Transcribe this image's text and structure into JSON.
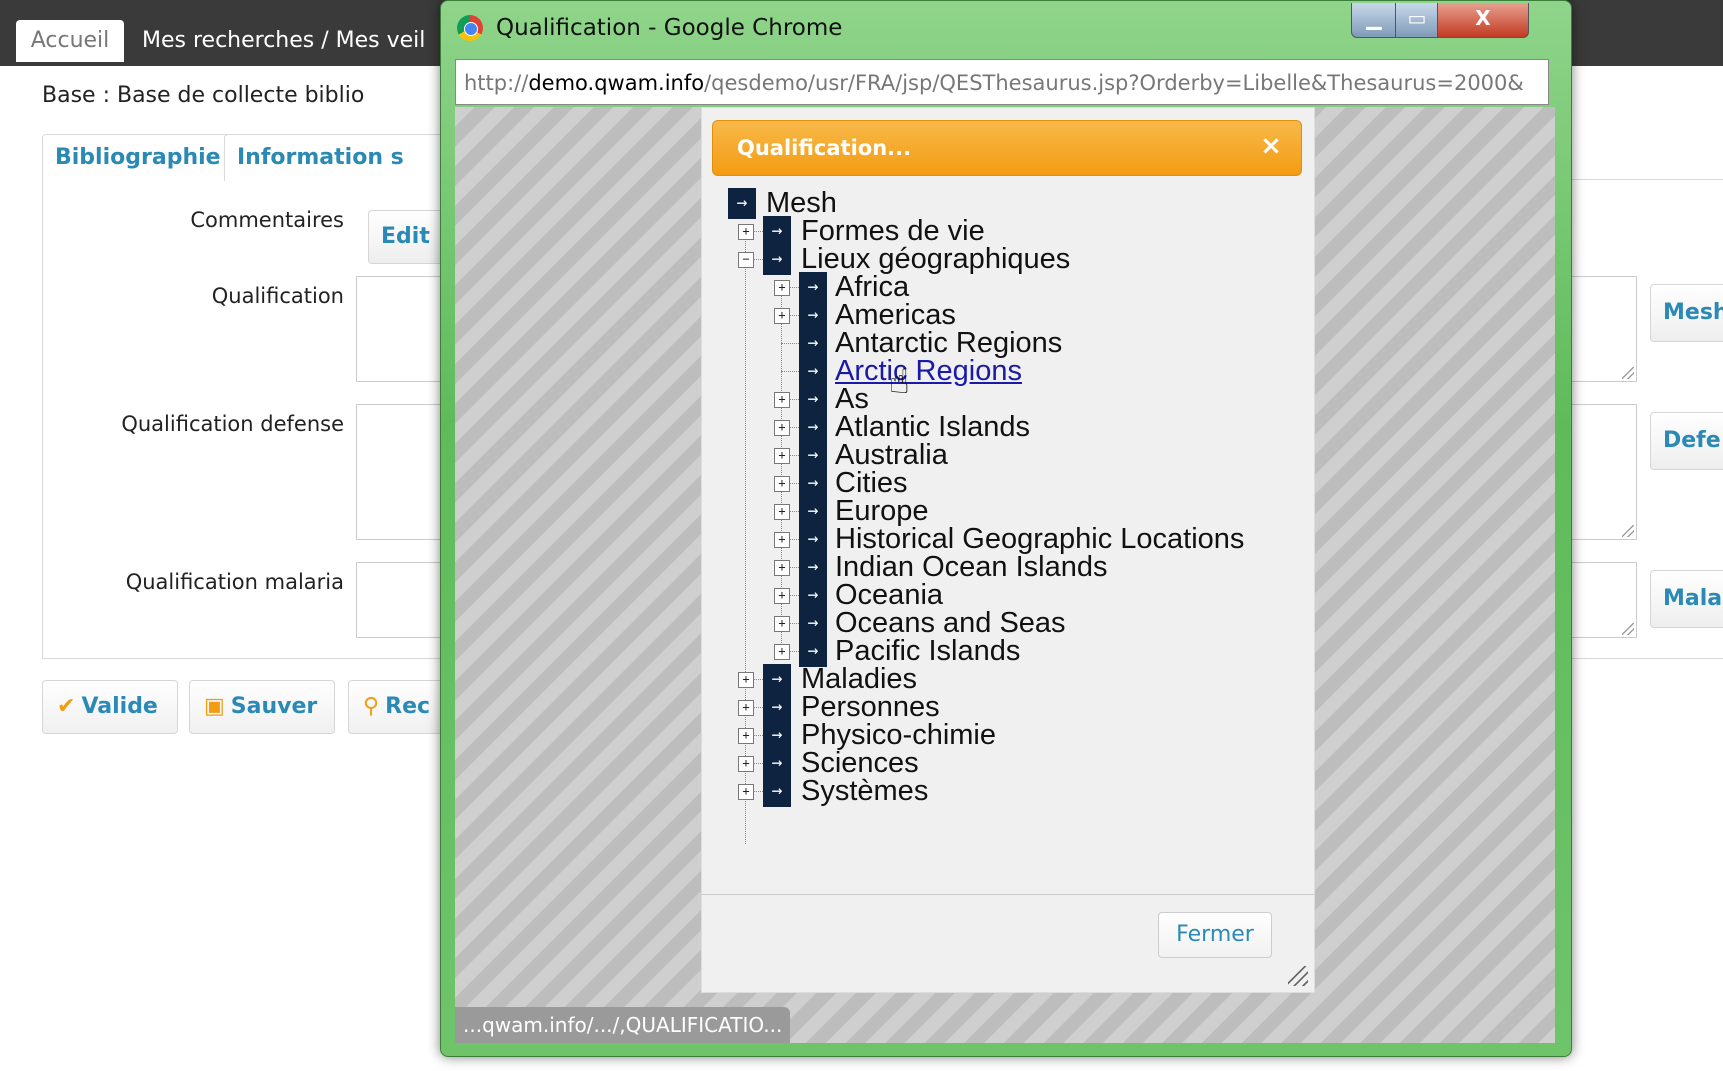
{
  "app": {
    "nav": {
      "accueil": "Accueil",
      "mes": "Mes recherches / Mes veil"
    },
    "base_label": "Base : Base de collecte biblio",
    "tabs": [
      "Bibliographie",
      "Information s"
    ],
    "fields": {
      "commentaires": "Commentaires",
      "edit_button": "Edit",
      "qualification": "Qualification",
      "qualification_defense": "Qualification defense",
      "qualification_malaria": "Qualification malaria"
    },
    "side_buttons": [
      "Mesh",
      "Defe",
      "Mala"
    ],
    "actions": {
      "valide": "Valide",
      "sauver": "Sauver",
      "rec": "Rec"
    }
  },
  "chrome": {
    "title": "Qualification - Google Chrome",
    "url_prefix": "http://",
    "url_domain": "demo.qwam.info",
    "url_path": "/qesdemo/usr/FRA/jsp/QESThesaurus.jsp?Orderby=Libelle&Thesaurus=2000&",
    "status": "...qwam.info/.../,QUALIFICATIO...",
    "close_glyph": "X"
  },
  "dialog": {
    "title": "Qualification...",
    "close_glyph": "×",
    "root": "Mesh",
    "level1_top": [
      "Formes de vie",
      "Lieux géographiques"
    ],
    "places": [
      "Africa",
      "Americas",
      "Antarctic Regions",
      "Arctic Regions",
      "As",
      "Atlantic Islands",
      "Australia",
      "Cities",
      "Europe",
      "Historical Geographic Locations",
      "Indian Ocean Islands",
      "Oceania",
      "Oceans and Seas",
      "Pacific Islands"
    ],
    "level1_bottom": [
      "Maladies",
      "Personnes",
      "Physico-chimie",
      "Sciences",
      "Systèmes"
    ],
    "close_button": "Fermer"
  },
  "colors": {
    "accent": "#2a8ab5",
    "dialog_header": "#f39c12",
    "tree_arrow_bg": "#0d2340",
    "link": "#1a1aa6"
  }
}
